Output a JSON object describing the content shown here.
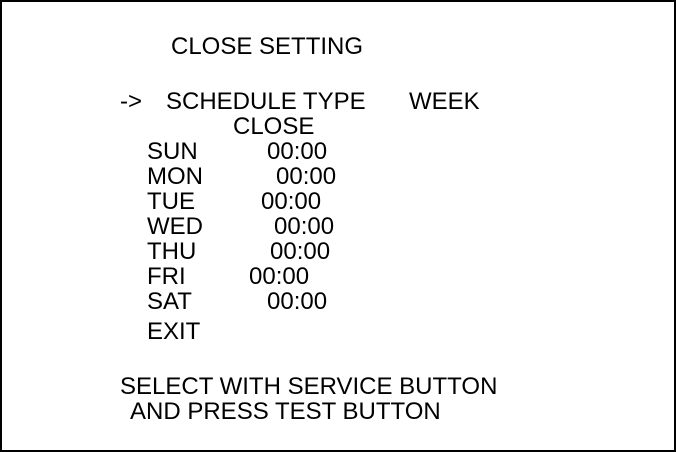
{
  "title": "CLOSE SETTING",
  "cursor": "->",
  "schedule": {
    "label": "SCHEDULE TYPE",
    "value": "WEEK"
  },
  "column_header": "CLOSE",
  "days": [
    {
      "day": "SUN",
      "time": "00:00"
    },
    {
      "day": "MON",
      "time": "00:00"
    },
    {
      "day": "TUE",
      "time": "00:00"
    },
    {
      "day": "WED",
      "time": "00:00"
    },
    {
      "day": "THU",
      "time": "00:00"
    },
    {
      "day": "FRI",
      "time": "00:00"
    },
    {
      "day": "SAT",
      "time": "00:00"
    }
  ],
  "exit_label": "EXIT",
  "footer": {
    "line1": "SELECT WITH SERVICE BUTTON",
    "line2": "AND PRESS TEST BUTTON"
  }
}
